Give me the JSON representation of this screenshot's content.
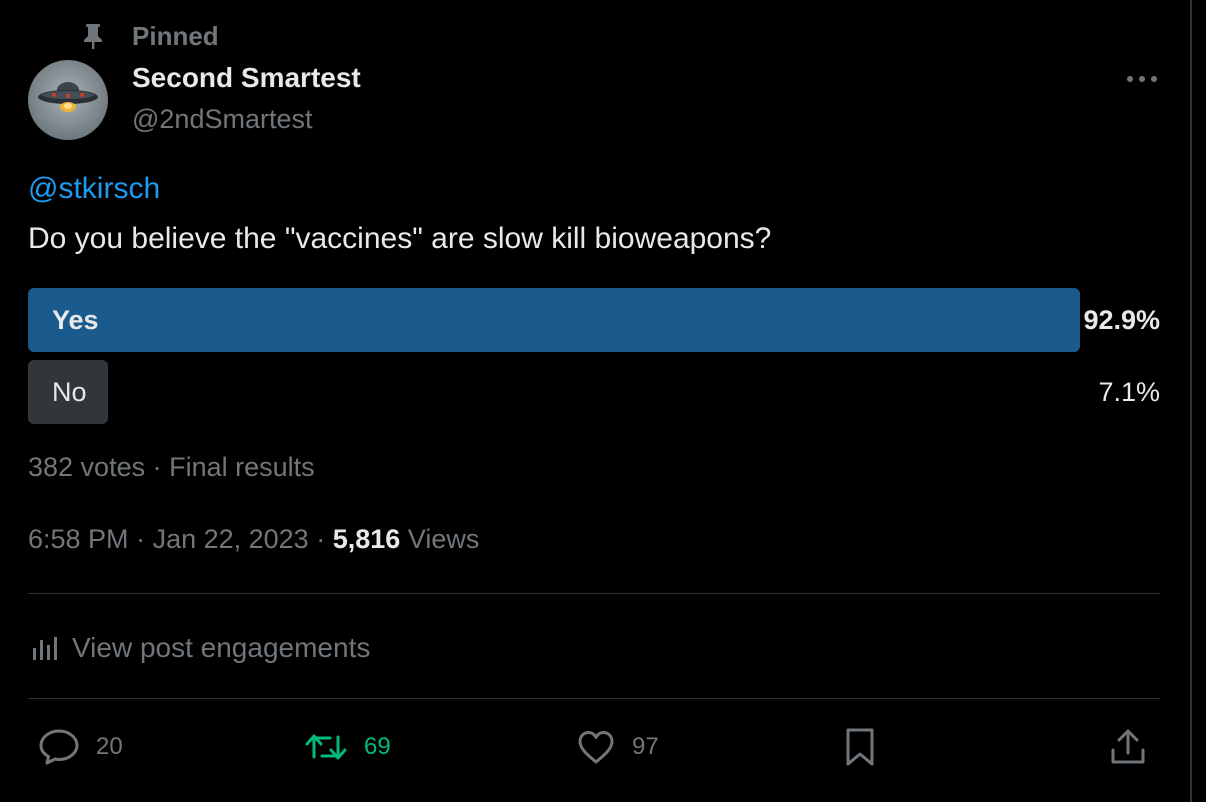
{
  "pinned": {
    "label": "Pinned"
  },
  "author": {
    "name": "Second Smartest",
    "handle": "@2ndSmartest"
  },
  "post": {
    "mention": "@stkirsch",
    "text": "Do you believe the \"vaccines\" are slow kill bioweapons?"
  },
  "poll": {
    "options": [
      {
        "label": "Yes",
        "percent": "92.9%",
        "value": 92.9
      },
      {
        "label": "No",
        "percent": "7.1%",
        "value": 7.1
      }
    ],
    "votes": "382 votes",
    "separator": " · ",
    "status": "Final results"
  },
  "meta": {
    "time": "6:58 PM",
    "date": "Jan 22, 2023",
    "separator": " · ",
    "views_count": "5,816",
    "views_label": "Views"
  },
  "engagements": {
    "label": "View post engagements"
  },
  "actions": {
    "replies": "20",
    "reposts": "69",
    "likes": "97"
  },
  "colors": {
    "background": "#000000",
    "text": "#e7e9ea",
    "secondary": "#71767b",
    "link": "#1d9bf0",
    "poll_winner": "#1a5a8c",
    "poll_other": "#333639",
    "repost_active": "#00ba7c"
  },
  "icons": [
    "pin-icon",
    "more-icon",
    "analytics-icon",
    "reply-icon",
    "repost-icon",
    "like-icon",
    "bookmark-icon",
    "share-icon"
  ]
}
